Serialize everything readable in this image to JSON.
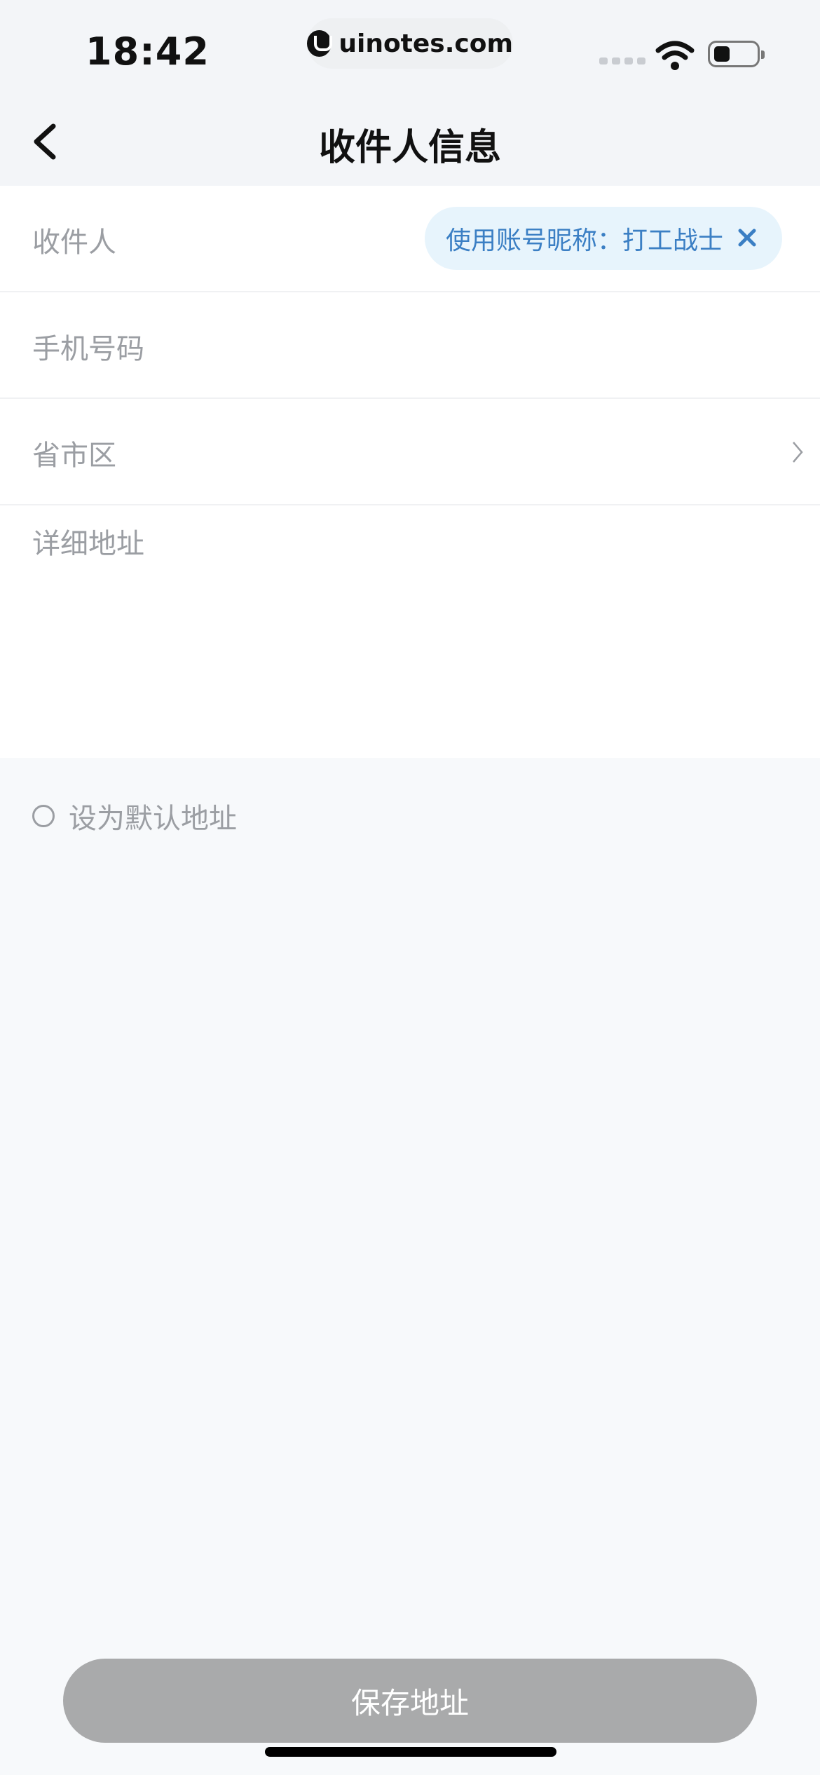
{
  "status_bar": {
    "time": "18:42",
    "site": "uinotes.com"
  },
  "header": {
    "title": "收件人信息"
  },
  "form": {
    "recipient_label": "收件人",
    "nickname_chip": "使用账号昵称：打工战士",
    "phone_label": "手机号码",
    "region_label": "省市区",
    "address_label": "详细地址"
  },
  "default_option": {
    "label": "设为默认地址"
  },
  "save_button": {
    "label": "保存地址"
  }
}
